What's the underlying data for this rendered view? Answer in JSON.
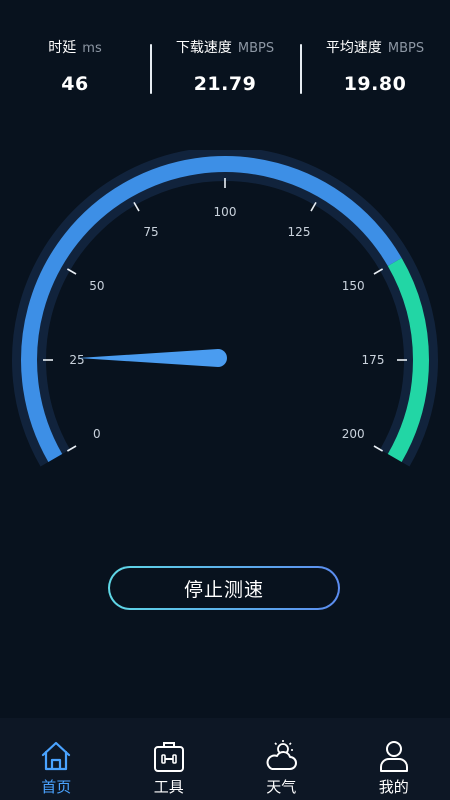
{
  "stats": [
    {
      "title": "时延",
      "unit": "ms",
      "value": "46"
    },
    {
      "title": "下载速度",
      "unit": "MBPS",
      "value": "21.79"
    },
    {
      "title": "平均速度",
      "unit": "MBPS",
      "value": "19.80"
    }
  ],
  "gauge": {
    "scale_labels": [
      "0",
      "25",
      "50",
      "75",
      "100",
      "125",
      "150",
      "175",
      "200"
    ],
    "scale_min": 0,
    "scale_max": 200,
    "needle_value": 25,
    "highlight_from": 150,
    "colors": {
      "arc": "#3d8fe6",
      "highlight": "#22d6a5",
      "needle": "#4a9cf0",
      "glow": "#13263f"
    }
  },
  "action": {
    "label": "停止测速"
  },
  "tabbar": {
    "items": [
      {
        "label": "首页",
        "icon": "home-icon",
        "active": true
      },
      {
        "label": "工具",
        "icon": "toolbox-icon",
        "active": false
      },
      {
        "label": "天气",
        "icon": "weather-icon",
        "active": false
      },
      {
        "label": "我的",
        "icon": "user-icon",
        "active": false
      }
    ]
  }
}
